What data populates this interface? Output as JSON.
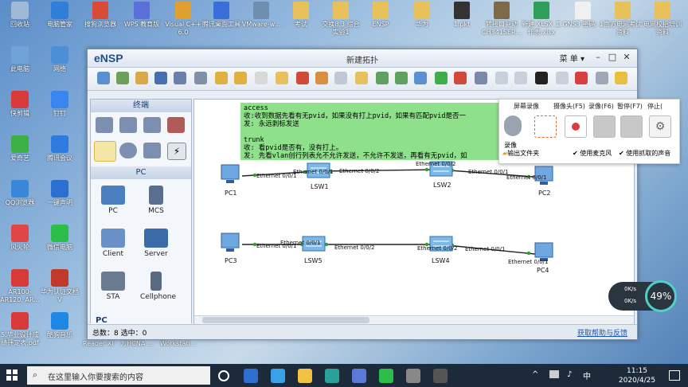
{
  "desktop": {
    "left_icons": [
      {
        "label": "回收站",
        "color": "#9fb9d6"
      },
      {
        "label": "此电脑",
        "color": "#6fa3d8"
      },
      {
        "label": "快剪辑",
        "color": "#d93b3b"
      },
      {
        "label": "爱奇艺",
        "color": "#3cb043"
      },
      {
        "label": "QQ浏览器",
        "color": "#3a86d8"
      },
      {
        "label": "风火轮",
        "color": "#e04646"
      },
      {
        "label": "AR100-AR120, AR...",
        "color": "#d83a3a"
      },
      {
        "label": "5.毕业设计成绩评定表.pdf",
        "color": "#d83a3a"
      }
    ],
    "second_col_icons": [
      {
        "label": "电脑管家",
        "color": "#2f7fd8"
      },
      {
        "label": "网络",
        "color": "#4a8fd8"
      },
      {
        "label": "钉钉",
        "color": "#3a86f0"
      },
      {
        "label": "腾讯会议",
        "color": "#2f7ae0"
      },
      {
        "label": "一键声明",
        "color": "#2b6fd0"
      },
      {
        "label": "微信电脑",
        "color": "#2dbd4a"
      },
      {
        "label": "华为认证文档 V",
        "color": "#c0392b"
      },
      {
        "label": "酷狗音乐",
        "color": "#1e88e5"
      }
    ],
    "top_icons": [
      {
        "label": "搜狗浏览器",
        "color": "#d84a3a"
      },
      {
        "label": "WPS 教育版",
        "color": "#5b6fd8"
      },
      {
        "label": "Visual C++ 6.0",
        "color": "#e0a030"
      },
      {
        "label": "腾讯桌面工具",
        "color": "#3a6fd8"
      },
      {
        "label": "VMware-w...",
        "color": "#6f8fb0"
      },
      {
        "label": "考试",
        "color": "#e8c15a"
      },
      {
        "label": "交换8.3 综合实验1",
        "color": "#e8c15a"
      },
      {
        "label": "ENSP",
        "color": "#e8c15a"
      },
      {
        "label": "华为",
        "color": "#e8c15a"
      },
      {
        "label": "1.pkt",
        "color": "#333333"
      },
      {
        "label": "转接口驱动CH341SER...",
        "color": "#7d6a4a"
      },
      {
        "label": "新建 XLSX 工作表.xlsx",
        "color": "#2f9e5a"
      },
      {
        "label": "GNS3 密码: 1",
        "color": "#f0f0f0"
      },
      {
        "label": "南方电网考试资料",
        "color": "#e8c15a"
      },
      {
        "label": "电网校招培训资料",
        "color": "#e8c15a"
      }
    ],
    "bottom_row_texts": [
      "Reader XI",
      "为HCNA ...",
      "Workstati..."
    ]
  },
  "ensp": {
    "logo": "eNSP",
    "title": "新建拓扑",
    "menu_label": "菜 单",
    "palette": {
      "section_devices": "终端",
      "section_pc": "PC",
      "devices": [
        {
          "label": "PC"
        },
        {
          "label": "MCS"
        },
        {
          "label": "Client"
        },
        {
          "label": "Server"
        },
        {
          "label": "STA"
        },
        {
          "label": "Cellphone"
        }
      ],
      "bottom_section": "PC"
    },
    "note_text": "access\n收:收到数据先看有无pvid，如果没有打上pvid，如果有匹配pvid是否一\n发: 永远剥标发送\n\ntrunk\n收: 看pvid是否有，没有打上。\n发: 先看vlan创行列表允不允许发送，不允许不发送，再看有无pvid，如",
    "nodes": [
      {
        "label": "PC1"
      },
      {
        "label": "LSW1"
      },
      {
        "label": "LSW2"
      },
      {
        "label": "PC2"
      },
      {
        "label": "PC3"
      },
      {
        "label": "LSW5"
      },
      {
        "label": "LSW4"
      },
      {
        "label": "PC4"
      }
    ],
    "ports": [
      "Ethernet 0/0/1",
      "Ethernet 0/0/1",
      "Ethernet 0/0/2",
      "Ethernet 0/0/2",
      "Ethernet 0/0/1",
      "Ethernet 0/0/1",
      "Ethernet 0/0/1",
      "Ethernet 0/0/1",
      "Ethernet 0/0/2",
      "Ethernet 0/0/2",
      "Ethernet 0/0/1",
      "Ethernet 0/0/1"
    ],
    "status": {
      "totals": "总数：8  选中：0",
      "help_link": "获取帮助与反馈"
    }
  },
  "recorder": {
    "tabs": [
      "屏幕录像",
      "摄像头(F5)",
      "录像(F6)",
      "暂停(F7)",
      "停止("
    ],
    "record_label": "录像",
    "output_folder": "输出文件夹",
    "use_mic": "使用麦克风",
    "use_system_audio": "使用抓取的声音"
  },
  "gauge": {
    "up": "0K/s",
    "down": "0K/s",
    "percent": "49%"
  },
  "taskbar": {
    "search_placeholder": "在这里输入你要搜索的内容",
    "time": "11:15",
    "date": "2020/4/25",
    "app_colors": [
      "#ffffff",
      "#2f6fd0",
      "#3aa0e8",
      "#f3c241",
      "#2aa198",
      "#5a7ad8",
      "#2dbd4a",
      "#888888"
    ]
  }
}
